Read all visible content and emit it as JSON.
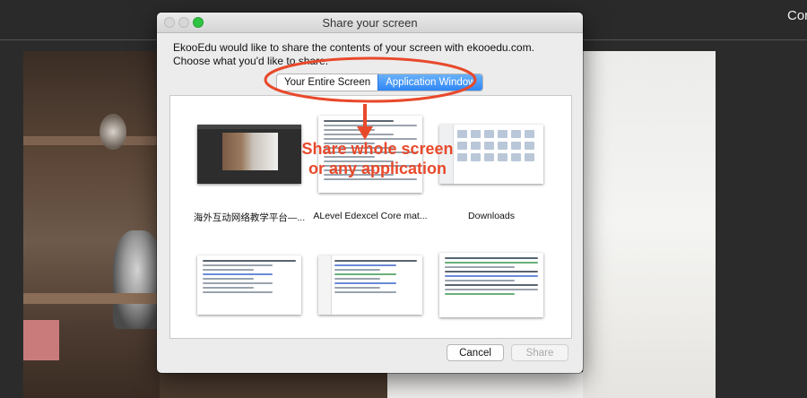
{
  "background_app": {
    "top_right_text": "Con"
  },
  "dialog": {
    "title": "Share your screen",
    "prompt": "EkooEdu would like to share the contents of your screen with ekooedu.com. Choose what you'd like to share.",
    "tabs": [
      {
        "label": "Your Entire Screen",
        "selected": false
      },
      {
        "label": "Application Window",
        "selected": true
      }
    ],
    "windows": [
      {
        "label": "海外互动网络教学平台—...",
        "thumb": "video-window"
      },
      {
        "label": "ALevel Edexcel Core mat...",
        "thumb": "document-window"
      },
      {
        "label": "Downloads",
        "thumb": "finder-window"
      },
      {
        "label": "",
        "thumb": "text-document-window"
      },
      {
        "label": "",
        "thumb": "code-editor-window"
      },
      {
        "label": "",
        "thumb": "code-listing-window"
      }
    ],
    "buttons": {
      "cancel": "Cancel",
      "share": "Share"
    }
  },
  "annotation": {
    "text_line1": "Share whole screen",
    "text_line2": "or any application",
    "color": "#e8492b"
  },
  "colors": {
    "selected_tab": "#2f86f5",
    "maximize_button": "#2fc442"
  }
}
